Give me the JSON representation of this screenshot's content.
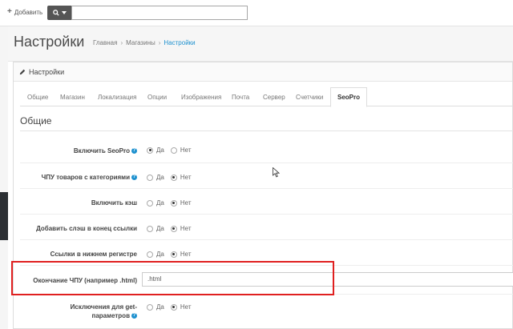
{
  "toolbar": {
    "add_label": "Добавить",
    "search_value": ""
  },
  "header": {
    "title": "Настройки",
    "breadcrumb": [
      "Главная",
      "Магазины",
      "Настройки"
    ]
  },
  "panel": {
    "heading": "Настройки"
  },
  "tabs": [
    {
      "label": "Общие"
    },
    {
      "label": "Магазин"
    },
    {
      "label": "Локализация"
    },
    {
      "label": "Опции"
    },
    {
      "label": "Изображения"
    },
    {
      "label": "Почта"
    },
    {
      "label": "Сервер"
    },
    {
      "label": "Счетчики"
    },
    {
      "label": "SeoPro",
      "active": true
    }
  ],
  "section_title": "Общие",
  "radio_labels": {
    "yes": "Да",
    "no": "Нет"
  },
  "settings": [
    {
      "label": "Включить SeoPro",
      "help": true,
      "value": "yes"
    },
    {
      "label": "ЧПУ товаров с категориями",
      "help": true,
      "value": "no"
    },
    {
      "label": "Включить кэш",
      "help": false,
      "value": "no"
    },
    {
      "label": "Добавить слэш в конец ссылки",
      "help": false,
      "value": "no"
    },
    {
      "label": "Ссылки в нижнем регистре",
      "help": false,
      "value": "no"
    },
    {
      "label": "Окончание ЧПУ (например .html)",
      "help": false,
      "input_value": ".html"
    },
    {
      "label_line1": "Исключения для get-",
      "label_line2": "параметров",
      "help": true,
      "value": "no"
    }
  ],
  "colors": {
    "accent": "#1e91cf",
    "highlight": "#e02020",
    "search_button": "#555555"
  }
}
